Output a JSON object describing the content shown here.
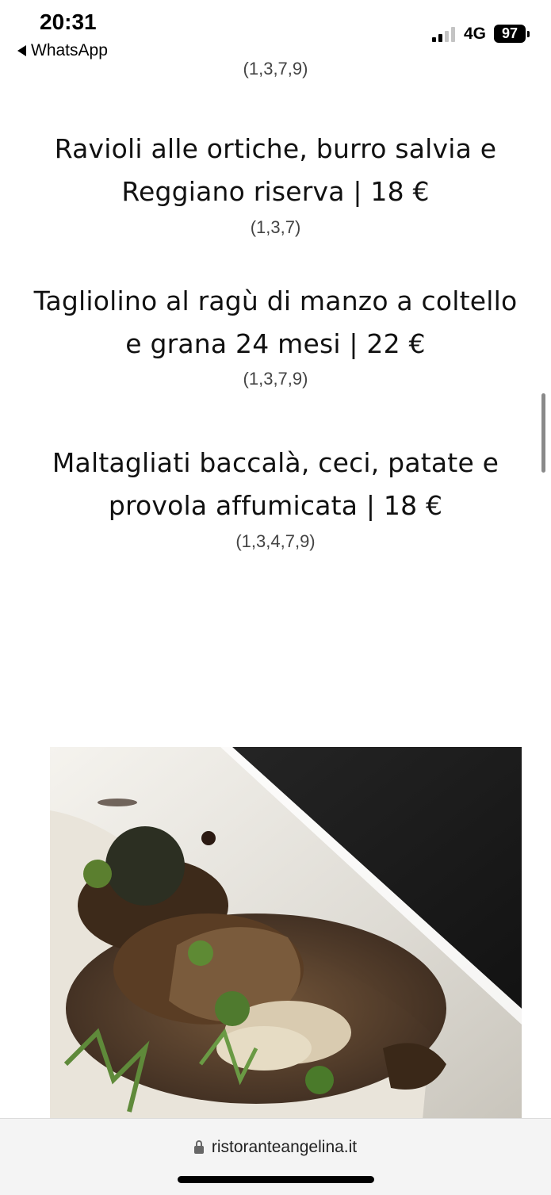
{
  "status_bar": {
    "time": "20:31",
    "back_app": "WhatsApp",
    "network": "4G",
    "battery": "97"
  },
  "menu": {
    "partial_allergens": "(1,3,7,9)",
    "dishes": [
      {
        "line1": "Ravioli alle ortiche, burro salvia e",
        "line2": "Reggiano riserva | 18 €",
        "allergens": "(1,3,7)"
      },
      {
        "line1": "Tagliolino al ragù di manzo a coltello",
        "line2": "e grana 24 mesi | 22 €",
        "allergens": "(1,3,7,9)"
      },
      {
        "line1": "Maltagliati baccalà, ceci, patate e",
        "line2": "provola affumicata | 18 €",
        "allergens": "(1,3,4,7,9)"
      }
    ]
  },
  "browser": {
    "url": "ristoranteangelina.it"
  },
  "icons": {
    "back": "back-triangle-icon",
    "signal": "signal-bars-icon",
    "battery": "battery-icon",
    "lock": "lock-icon"
  }
}
